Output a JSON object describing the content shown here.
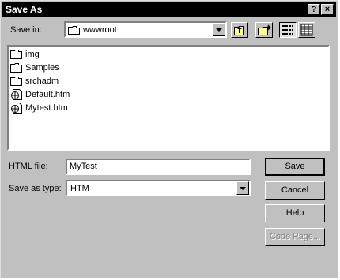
{
  "window": {
    "title": "Save As",
    "help_glyph": "?",
    "close_glyph": "×"
  },
  "save_in": {
    "label": "Save in:",
    "value": "wwwroot"
  },
  "files": [
    {
      "name": "img",
      "type": "folder"
    },
    {
      "name": "Samples",
      "type": "folder"
    },
    {
      "name": "srchadm",
      "type": "folder"
    },
    {
      "name": "Default.htm",
      "type": "html-file"
    },
    {
      "name": "Mytest.htm",
      "type": "html-file"
    }
  ],
  "file_name": {
    "label": "HTML file:",
    "value": "MyTest"
  },
  "save_type": {
    "label": "Save as type:",
    "value": "HTM"
  },
  "buttons": {
    "save": "Save",
    "cancel": "Cancel",
    "help": "Help",
    "code_page": "Code Page..."
  },
  "icons": {
    "up": "up-one-level-icon",
    "new_folder": "create-new-folder-icon",
    "list": "list-view-icon",
    "details": "details-view-icon"
  }
}
